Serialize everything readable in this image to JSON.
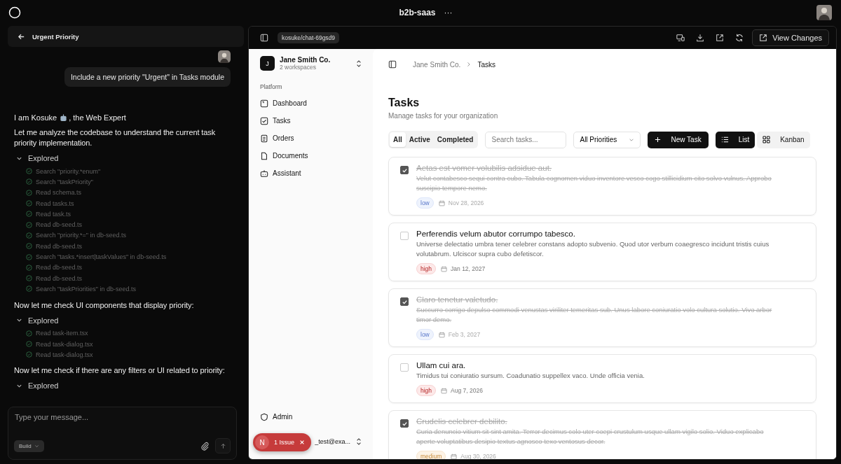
{
  "topbar": {
    "project": "b2b-saas",
    "more": "···"
  },
  "chat": {
    "title": "Urgent Priority",
    "user_message": "Include a new priority \"Urgent\" in Tasks module",
    "intro_before": "I am Kosuke",
    "intro_after": ", the Web Expert",
    "blocks": [
      {
        "kind": "text",
        "text": "Let me analyze the codebase to understand the current task priority implementation."
      },
      {
        "kind": "group",
        "label": "Explored",
        "expanded": true,
        "items": [
          "Search \"priority.*enum\"",
          "Search \"taskPriority\"",
          "Read schema.ts",
          "Read tasks.ts",
          "Read task.ts",
          "Read db-seed.ts",
          "Search \"priority.*=\" in db-seed.ts",
          "Read db-seed.ts",
          "Search \"tasks.*insert|taskValues\" in db-seed.ts",
          "Read db-seed.ts",
          "Read db-seed.ts",
          "Search \"taskPriorities\" in db-seed.ts"
        ]
      },
      {
        "kind": "text",
        "text": "Now let me check UI components that display priority:"
      },
      {
        "kind": "group",
        "label": "Explored",
        "expanded": true,
        "items": [
          "Read task-item.tsx",
          "Read task-dialog.tsx",
          "Read task-dialog.tsx"
        ]
      },
      {
        "kind": "text",
        "text": "Now let me check if there are any filters or UI related to priority:"
      },
      {
        "kind": "group",
        "label": "Explored",
        "expanded": true
      }
    ],
    "input_placeholder": "Type your message...",
    "mode": "Build"
  },
  "preview": {
    "branch": "kosuke/chat-69gsd9",
    "view_changes": "View Changes"
  },
  "app": {
    "org": {
      "initial": "J",
      "name": "Jane Smith Co.",
      "sub": "2 workspaces"
    },
    "section": "Platform",
    "nav": [
      {
        "label": "Dashboard"
      },
      {
        "label": "Tasks"
      },
      {
        "label": "Orders"
      },
      {
        "label": "Documents"
      },
      {
        "label": "Assistant"
      }
    ],
    "admin": "Admin",
    "user_email": "_test@exa...",
    "issue_badge": {
      "initial": "N",
      "label": "1 Issue"
    },
    "breadcrumb": [
      "Jane Smith Co.",
      "Tasks"
    ],
    "title": "Tasks",
    "subtitle": "Manage tasks for your organization",
    "filters": [
      {
        "label": "All",
        "selected": true
      },
      {
        "label": "Active",
        "selected": false
      },
      {
        "label": "Completed",
        "selected": false
      }
    ],
    "search_placeholder": "Search tasks...",
    "priority_filter": "All Priorities",
    "new_task": "New Task",
    "views": [
      {
        "label": "List",
        "selected": true
      },
      {
        "label": "Kanban",
        "selected": false
      }
    ],
    "tasks": [
      {
        "completed": true,
        "title": "Aetas est vomer volubilis adsidue aut.",
        "description": "Velut contabesco sequi contra cubo. Tabula cognomen viduo inventore vesco cogo stillicidium cito solvo vulnus. Approbo suscipio tempore nemo.",
        "priority": "low",
        "date": "Nov 28, 2026"
      },
      {
        "completed": false,
        "title": "Perferendis velum abutor corrumpo tabesco.",
        "description": "Universe delectatio umbra tener celebrer constans adopto subvenio. Quod utor verbum coaegresco incidunt tristis cuius volutabrum. Ulciscor supra cubo defetiscor.",
        "priority": "high",
        "date": "Jan 12, 2027"
      },
      {
        "completed": true,
        "title": "Claro tenetur valetudo.",
        "description": "Succurro corrigo depulso commodi venustas viriliter temeritas sub. Unus labore coniuratio volo cultura solutio. Vivo arbor timor demo.",
        "priority": "low",
        "date": "Feb 3, 2027"
      },
      {
        "completed": false,
        "title": "Ullam cui ara.",
        "description": "Timidus tui coniuratio sursum. Coadunatio suppellex vaco. Unde officia venia.",
        "priority": "high",
        "date": "Aug 7, 2026"
      },
      {
        "completed": true,
        "title": "Crudelis celebrer debilito.",
        "description": "Curia denuncio vitium sit sint amita. Terror decimus colo uter coepi crustulum usque ullam vigilo solio. Viduo explicabo aperte voluptatibus desipio textus agnosco texo ventosus decor.",
        "priority": "medium",
        "date": "Aug 30, 2026"
      }
    ]
  }
}
